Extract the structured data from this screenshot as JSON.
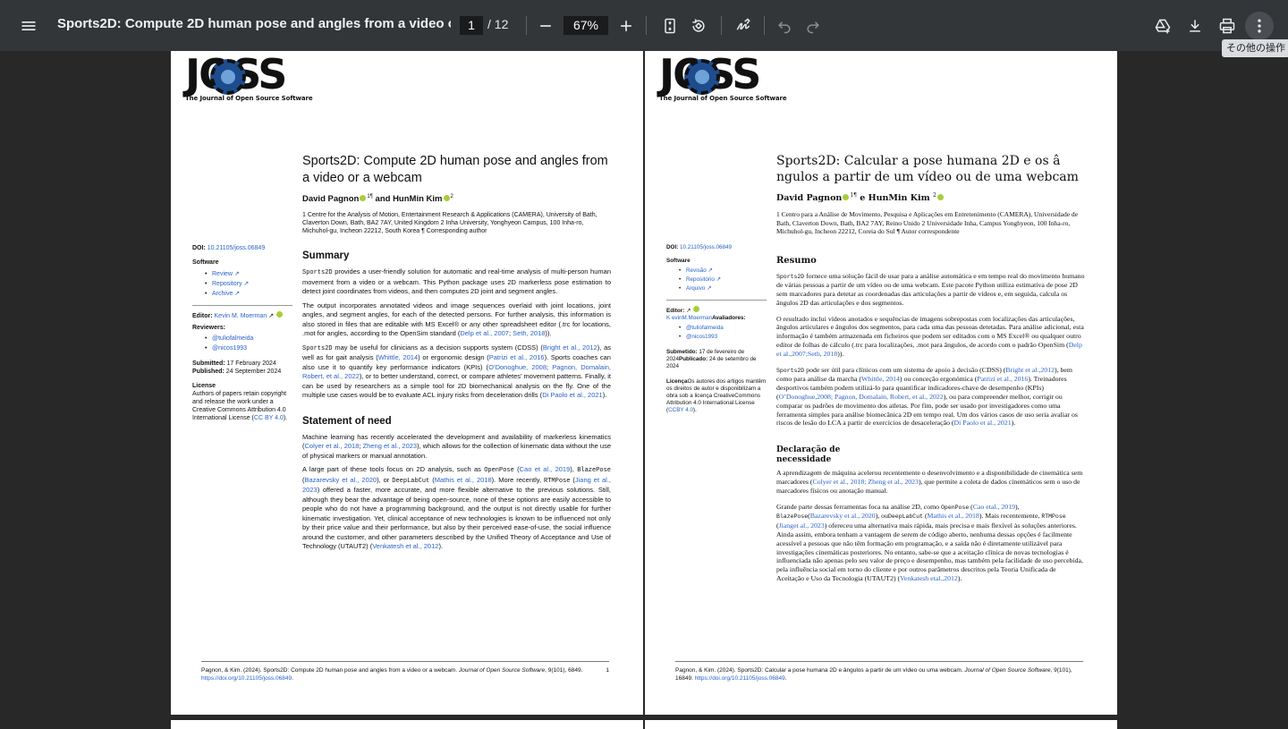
{
  "toolbar": {
    "title": "Sports2D: Compute 2D human pose and angles from a video or ...",
    "page_current": "1",
    "page_sep": "/ 12",
    "zoom": "67%",
    "tooltip": "その他の操作"
  },
  "logo": {
    "text": "JOSS",
    "subtitle": "The Journal of Open Source Software"
  },
  "page1": {
    "doi_label": "DOI:",
    "doi": "10.21105/joss.06849",
    "software_label": "Software",
    "software": [
      "Review",
      "Repository",
      "Archive"
    ],
    "editor_label": "Editor:",
    "editor": "Kevin M. Moerman",
    "reviewers_label": "Reviewers:",
    "reviewers": [
      "@tuliofalmeida",
      "@nicos1993"
    ],
    "submitted_label": "Submitted:",
    "submitted": "17 February 2024",
    "published_label": "Published:",
    "published": "24 September 2024",
    "license_label": "License",
    "license_text": "Authors of papers retain copyright and release the work under a Creative Commons Attribution 4.0 International License (",
    "license_link": "CC BY 4.0",
    "license_end": ").",
    "title": "Sports2D: Compute 2D human pose and angles from a video or a webcam",
    "author1": "David Pagnon",
    "author1_sup": "1¶",
    "author_and": "and HunMin Kim",
    "author2_sup": "2",
    "affiliations": "1 Centre for the Analysis of Motion, Entertainment Research & Applications (CAMERA), University of Bath, Claverton Down, Bath, BA2 7AY, United Kingdom 2 Inha University, Yonghyeon Campus, 100 Inha-ro, Michuhol-gu, Incheon 22212, South Korea ¶ Corresponding author",
    "summary_h": "Summary",
    "summary_p1_a": "Sports2D",
    "summary_p1_b": " provides a user-friendly solution for automatic and real-time analysis of multi-person human movement from a video or a webcam. This Python package uses 2D markerless pose estimation to detect joint coordinates from videos, and then computes 2D joint and segment angles.",
    "summary_p2": "The output incorporates annotated videos and image sequences overlaid with joint locations, joint angles, and segment angles, for each of the detected persons. For further analysis, this information is also stored in files that are editable with MS Excel® or any other spreadsheet editor (.trc for locations, .mot for angles, according to the OpenSim standard (",
    "summary_p2_ref1": "Delp et al., 2007",
    "summary_p2_ref2": "Seth, 2018",
    "summary_p2_end": ")).",
    "summary_p3_a": "Sports2D",
    "summary_p3_b": " may be useful for clinicians as a decision supports system (CDSS) (",
    "summary_p3_r1": "Bright et al., 2012",
    "summary_p3_c": "), as well as for gait analysis (",
    "summary_p3_r2": "Whittle, 2014",
    "summary_p3_d": ") or ergonomic design (",
    "summary_p3_r3": "Patrizi et al., 2016",
    "summary_p3_e": "). Sports coaches can also use it to quantify key performance indicators (KPIs) (",
    "summary_p3_r4": "O’Donoghue, 2008",
    "summary_p3_r5": "Pagnon, Domalain, Robert, et al., 2022",
    "summary_p3_f": "), or to better understand, correct, or compare athletes’ movement patterns. Finally, it can be used by researchers as a simple tool for 2D biomechanical analysis on the fly. One of the multiple use cases would be to evaluate ACL injury risks from deceleration drills (",
    "summary_p3_r6": "Di Paolo et al., 2021",
    "summary_p3_g": ").",
    "need_h": "Statement of need",
    "need_p1_a": "Machine learning has recently accelerated the development and availability of markerless kinematics (",
    "need_p1_r1": "Colyer et al., 2018",
    "need_p1_r2": "Zheng et al., 2023",
    "need_p1_b": "), which allows for the collection of kinematic data without the use of physical markers or manual annotation.",
    "need_p2_a": "A large part of these tools focus on 2D analysis, such as ",
    "need_p2_m1": "OpenPose",
    "need_p2_r1": "Cao et al., 2019",
    "need_p2_m2": "BlazePose",
    "need_p2_r2": "Bazarevsky et al., 2020",
    "need_p2_b": "), or ",
    "need_p2_m3": "DeepLabCut",
    "need_p2_r3": "Mathis et al., 2018",
    "need_p2_c": "). More recently, ",
    "need_p2_m4": "RTMPose",
    "need_p2_r4": "Jiang et al., 2023",
    "need_p2_d": ") offered a faster, more accurate, and more flexible alternative to the previous solutions. Still, although they bear the advantage of being open-source, none of these options are easily accessible to people who do not have a programming background, and the output is not directly usable for further kinematic investigation. Yet, clinical acceptance of new technologies is known to be influenced not only by their price value and their performance, but also by their perceived ease-of-use, the social influence around the customer, and other parameters described by the Unified Theory of Acceptance and Use of Technology (UTAUT2) (",
    "need_p2_r5": "Venkatesh et al., 2012",
    "need_p2_e": ").",
    "footer_a": "Pagnon, & Kim. (2024). Sports2D: Compute 2D human pose and angles from a video or a webcam. ",
    "footer_journal": "Journal of Open Source Software",
    "footer_b": ", 9(101), 6849. ",
    "footer_link": "https://doi.org/10.21105/joss.06849",
    "footer_end": ".",
    "page_number": "1"
  },
  "page2": {
    "doi_label": "DOI:",
    "doi": "10.21105/joss.06849",
    "software_label": "Software",
    "software": [
      "Revisão",
      "Repositório",
      "Arquivo"
    ],
    "editor_label": "Editor:",
    "editor_reviewers": "K evinM.Moerman",
    "reviewers_label": "Avaliadores:",
    "reviewers": [
      "@tuliofalmeida",
      "@nicos1993"
    ],
    "submitted_label": "Submetido:",
    "submitted": "17 de fevereiro de 2024",
    "published_label": "Publicado:",
    "published": "24 de setembro de 2024",
    "license_label": "Licença",
    "license_text": "Os autores dos artigos mantêm os direitos de autor e disponibilizam a obra sob a licença CreativeCommons Attribution 4.0 International License (",
    "license_link": "CCBY 4.0",
    "license_end": ").",
    "title": "Sports2D: Calcular a pose humana 2D e os â ngulos a partir de um vídeo ou de uma webcam",
    "author1": "David Pagnon",
    "author1_sup": "1¶",
    "author_and": "e HunMin Kim",
    "author2_sup": "2",
    "affiliations": "1 Centro para a Análise de Movimento, Pesquisa e Aplicações em Entretenimento (CAMERA), Universidade de Bath, Claverton Down, Bath, BA2 7AY, Reino Unido 2 Universidade Inha, Campus Yonghyeon, 100 Inha-ro, Michuhol-gu, Incheon 22212, Coreia do Sul ¶ Autor correspondente",
    "summary_h": "Resumo",
    "summary_p1_a": "Sports2D",
    "summary_p1_b": " fornece uma solução fácil de usar para a análise automática e em tempo real do movimento humano de várias pessoas a partir de um vídeo ou de uma webcam. Este pacote Python utiliza estimativa de pose 2D sem marcadores para detetar as coordenadas das articulações a partir de vídeos e, em seguida, calcula os ângulos 2D das articulações e dos segmentos.",
    "summary_p2": "O resultado inclui vídeos anotados e sequências de imagens sobrepostas com localizações das articulações, ângulos articulares e ângulos dos segmentos, para cada uma das pessoas detetadas. Para análise adicional, esta informação é também armazenada em ficheiros que podem ser editados com o MS Excel® ou qualquer outro editor de folhas de cálculo (.trc para localizações, .mot para ângulos, de acordo com o padrão OpenSim (",
    "summary_p2_ref1": "Delp et al.,2007;Seth, 2018",
    "summary_p2_end": ")).",
    "summary_p3_a": "Sports2D",
    "summary_p3_b": " pode ser útil para clínicos com um sistema de apoio à decisão (CDSS) (",
    "summary_p3_r1": "Bright et al.,2012",
    "summary_p3_c": "), bem como para análise da marcha (",
    "summary_p3_r2": "Whittle, 2014",
    "summary_p3_d": ") ou conceção ergonómica (",
    "summary_p3_r3": "Patrizi et al., 2016",
    "summary_p3_e": "). Treinadores desportivos também podem utilizá-lo para quantificar indicadores-chave de desempenho (KPIs) (",
    "summary_p3_r4": "O’Donoghue,2008; Pagnon, Domalain, Robert, et al., 2022",
    "summary_p3_f": "), ou para compreender melhor, corrigir ou comparar os padrões de movimento dos atletas. Por fim, pode ser usado por investigadores como uma ferramenta simples para análise biomecânica 2D em tempo real. Um dos vários casos de uso seria avaliar os riscos de lesão do LCA a partir de exercícios de desaceleração (",
    "summary_p3_r6": "Di Paolo et al., 2021",
    "summary_p3_g": ").",
    "need_h1": "Declaração de",
    "need_h2": "necessidade",
    "need_p1_a": "A aprendizagem de máquina acelerou recentemente o desenvolvimento e a disponibilidade de cinemática sem marcadores (",
    "need_p1_r1": "Colyer et al., 2018; Zheng et al., 2023",
    "need_p1_b": "), que permite a coleta de dados cinemáticos sem o uso de marcadores físicos ou anotação manual.",
    "need_p2_a": "Grande parte dessas ferramentas foca na análise 2D, como ",
    "need_p2_m1": "OpenPose",
    "need_p2_r1": "Cao etal., 2019",
    "need_p2_m2": "BlazePose",
    "need_p2_r2": "Bazarevsky et al., 2020",
    "need_p2_b": "), ou",
    "need_p2_m3": "DeepLabCut",
    "need_p2_r3": "Mathis et al., 2018",
    "need_p2_c": "). Mais recentemente, ",
    "need_p2_m4": "RTMPose",
    "need_p2_r4": "Jianget al., 2023",
    "need_p2_d": ") ofereceu uma alternativa mais rápida, mais precisa e mais flexível às soluções anteriores. Ainda assim, embora tenham a vantagem de serem de código aberto, nenhuma dessas opções é facilmente acessível a pessoas que não têm formação em programação, e a saída não é diretamente utilizável para investigações cinemáticas posteriores. No entanto, sabe-se que a aceitação clínica de novas tecnologias é influenciada não apenas pelo seu valor de preço e desempenho, mas também pela facilidade de uso percebida, pela influência social em torno do cliente e por outros parâmetros descritos pela Teoria Unificada de Aceitação e Uso da Tecnologia (UTAUT2) (",
    "need_p2_r5": "Venkatesh etal.,2012",
    "need_p2_e": ").",
    "footer_a": "Pagnon, & Kim. (2024). Sports2D: Calcular a pose humana 2D e ângulos a partir de um vídeo ou uma webcam. ",
    "footer_journal": "Journal of Open Source Software",
    "footer_b": ", 9(101), 16849. ",
    "footer_link": "https://doi.org/10.21105/joss.06849",
    "footer_end": "."
  }
}
